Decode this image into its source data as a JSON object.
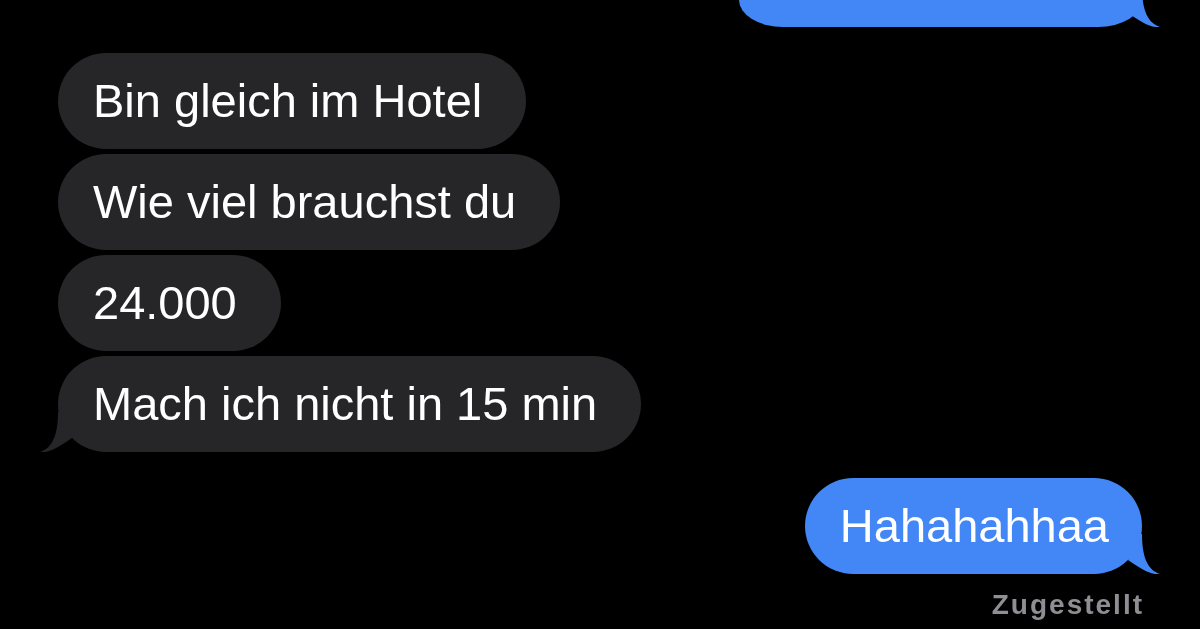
{
  "messages": [
    {
      "kind": "outgoing",
      "tail": true
    },
    {
      "kind": "incoming",
      "text": "Bin gleich im Hotel",
      "tail": false
    },
    {
      "kind": "incoming",
      "text": "Wie viel brauchst du",
      "tail": false
    },
    {
      "kind": "incoming",
      "text": "24.000",
      "tail": false
    },
    {
      "kind": "incoming",
      "text": "Mach ich nicht in 15 min",
      "tail": true
    },
    {
      "kind": "outgoing",
      "text": "Hahahahhaa",
      "tail": true
    }
  ],
  "delivery_status": "Zugestellt"
}
